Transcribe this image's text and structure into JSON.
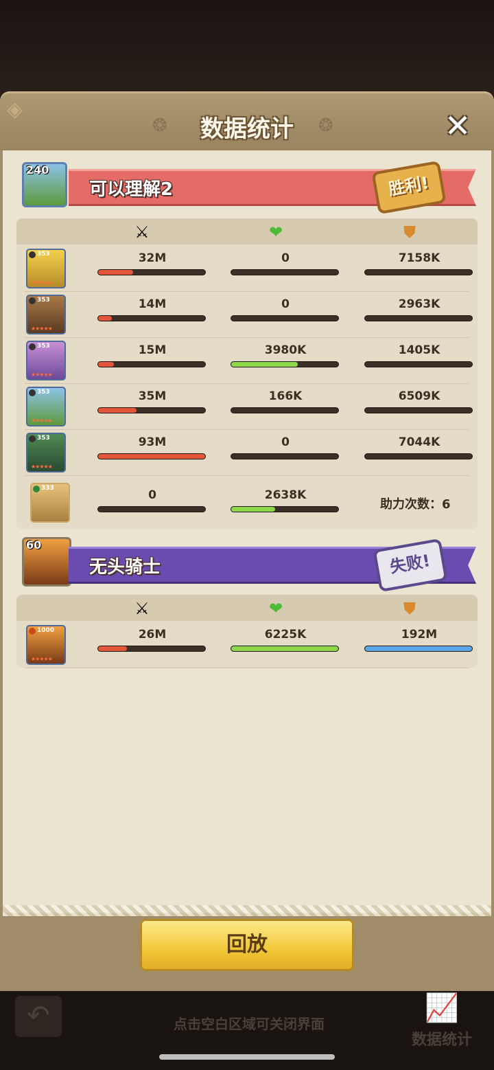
{
  "panel": {
    "title": "数据统计"
  },
  "team1": {
    "name": "可以理解2",
    "level": "240",
    "result": "胜利!",
    "heroes": [
      {
        "level": "353",
        "damage": "32M",
        "heal": "0",
        "tank": "7158K",
        "damage_pct": 0.33,
        "heal_pct": 0,
        "tank_pct": 0
      },
      {
        "level": "353",
        "damage": "14M",
        "heal": "0",
        "tank": "2963K",
        "damage_pct": 0.13,
        "heal_pct": 0,
        "tank_pct": 0
      },
      {
        "level": "353",
        "damage": "15M",
        "heal": "3980K",
        "tank": "1405K",
        "damage_pct": 0.15,
        "heal_pct": 0.62,
        "tank_pct": 0
      },
      {
        "level": "353",
        "damage": "35M",
        "heal": "166K",
        "tank": "6509K",
        "damage_pct": 0.36,
        "heal_pct": 0,
        "tank_pct": 0
      },
      {
        "level": "353",
        "damage": "93M",
        "heal": "0",
        "tank": "7044K",
        "damage_pct": 1.0,
        "heal_pct": 0,
        "tank_pct": 0
      }
    ],
    "pet": {
      "level": "333",
      "damage": "0",
      "heal": "2638K",
      "damage_pct": 0,
      "heal_pct": 0.41,
      "assist_label": "助力次数：6"
    }
  },
  "team2": {
    "name": "无头骑士",
    "level": "60",
    "result": "失败!",
    "heroes": [
      {
        "level": "1000",
        "damage": "26M",
        "heal": "6225K",
        "tank": "192M",
        "damage_pct": 0.27,
        "heal_pct": 1.0,
        "tank_pct": 1.0
      }
    ]
  },
  "icons": {
    "damage": "crossed-swords-icon",
    "heal": "heart-plus-icon",
    "tank": "shield-icon"
  },
  "replay_label": "回放",
  "close_hint": "点击空白区域可关闭界面",
  "stats_button_label": "数据统计",
  "colors": {
    "damage": "#e2573a",
    "heal": "#8fd84a",
    "tank": "#5ba6e6",
    "win_banner": "#e46b66",
    "lose_banner": "#6a4bb0"
  }
}
